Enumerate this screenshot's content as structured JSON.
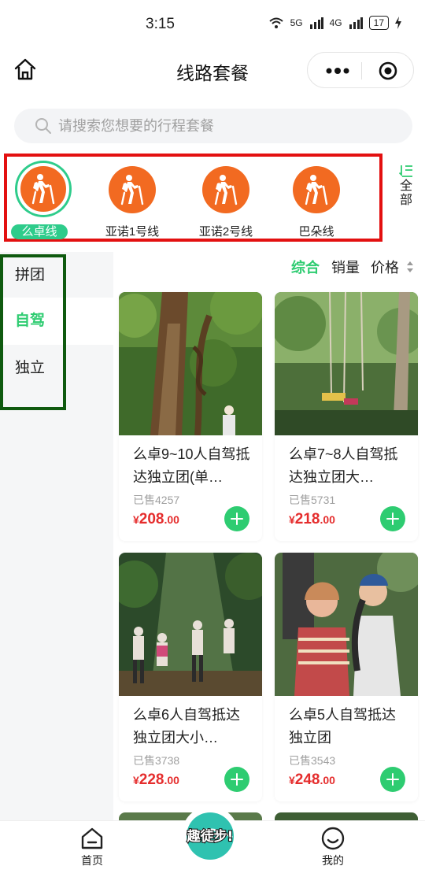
{
  "status_bar": {
    "time": "3:15",
    "network_a": "5G",
    "network_b": "4G",
    "battery": "17"
  },
  "header": {
    "title": "线路套餐"
  },
  "search": {
    "placeholder": "请搜索您想要的行程套餐"
  },
  "routes": [
    {
      "label": "么卓线",
      "active": true
    },
    {
      "label": "亚诺1号线",
      "active": false
    },
    {
      "label": "亚诺2号线",
      "active": false
    },
    {
      "label": "巴朵线",
      "active": false
    }
  ],
  "all_button": {
    "label": "全部"
  },
  "categories": [
    {
      "label": "拼团",
      "active": false
    },
    {
      "label": "自驾",
      "active": true
    },
    {
      "label": "独立",
      "active": false
    }
  ],
  "sort": {
    "overall": "综合",
    "sales": "销量",
    "price": "价格"
  },
  "products": [
    {
      "title": "么卓9~10人自驾抵达独立团(单…",
      "sold": "已售4257",
      "currency": "¥",
      "price_int": "208",
      "price_dec": ".00"
    },
    {
      "title": "么卓7~8人自驾抵达独立团大…",
      "sold": "已售5731",
      "currency": "¥",
      "price_int": "218",
      "price_dec": ".00"
    },
    {
      "title": "么卓6人自驾抵达独立团大小…",
      "sold": "已售3738",
      "currency": "¥",
      "price_int": "228",
      "price_dec": ".00"
    },
    {
      "title": "么卓5人自驾抵达独立团",
      "sold": "已售3543",
      "currency": "¥",
      "price_int": "248",
      "price_dec": ".00"
    }
  ],
  "tabbar": {
    "home": "首页",
    "logo_text": "趣徒步!",
    "mine": "我的"
  },
  "colors": {
    "accent_green": "#2ecc71",
    "route_orange": "#f26a21",
    "price_red": "#e52d2d",
    "highlight_red": "#e31010",
    "highlight_dark_green": "#0f5a0f"
  }
}
